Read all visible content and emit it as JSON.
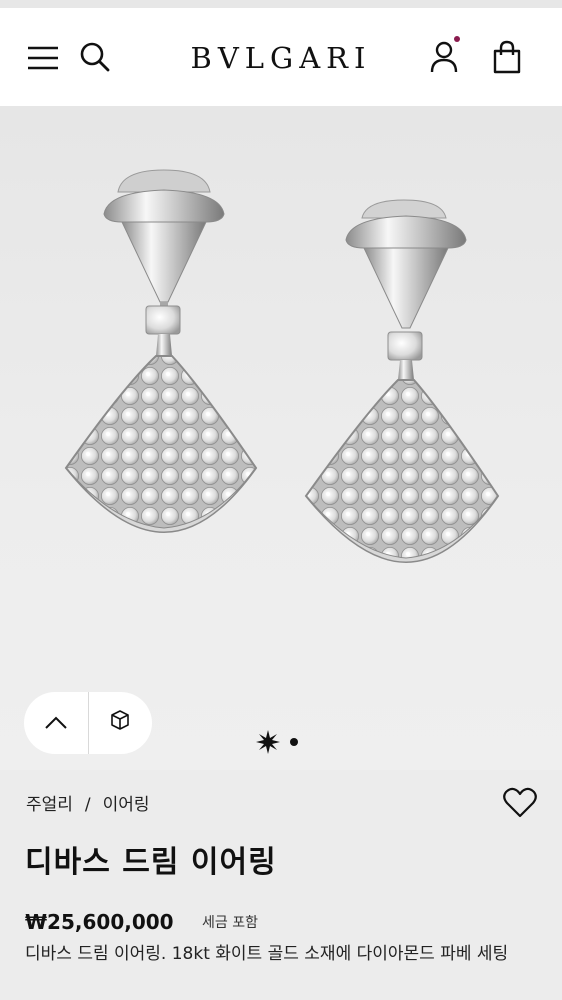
{
  "header": {
    "brand": "BVLGARI",
    "icons": [
      "menu-icon",
      "search-icon",
      "account-icon",
      "bag-icon"
    ],
    "notification_color": "#8a1b4e"
  },
  "gallery": {
    "controls": [
      "chevron-up-icon",
      "cube-3d-icon"
    ],
    "slide_count": 2,
    "active_slide": 1
  },
  "product": {
    "breadcrumb": [
      "주얼리",
      "이어링"
    ],
    "breadcrumb_separator": "/",
    "title": "디바스 드림 이어링",
    "price": "₩25,600,000",
    "tax_note": "세금 포함",
    "description": "디바스 드림 이어링. 18kt 화이트 골드 소재에 다이아몬드 파베 세팅"
  }
}
